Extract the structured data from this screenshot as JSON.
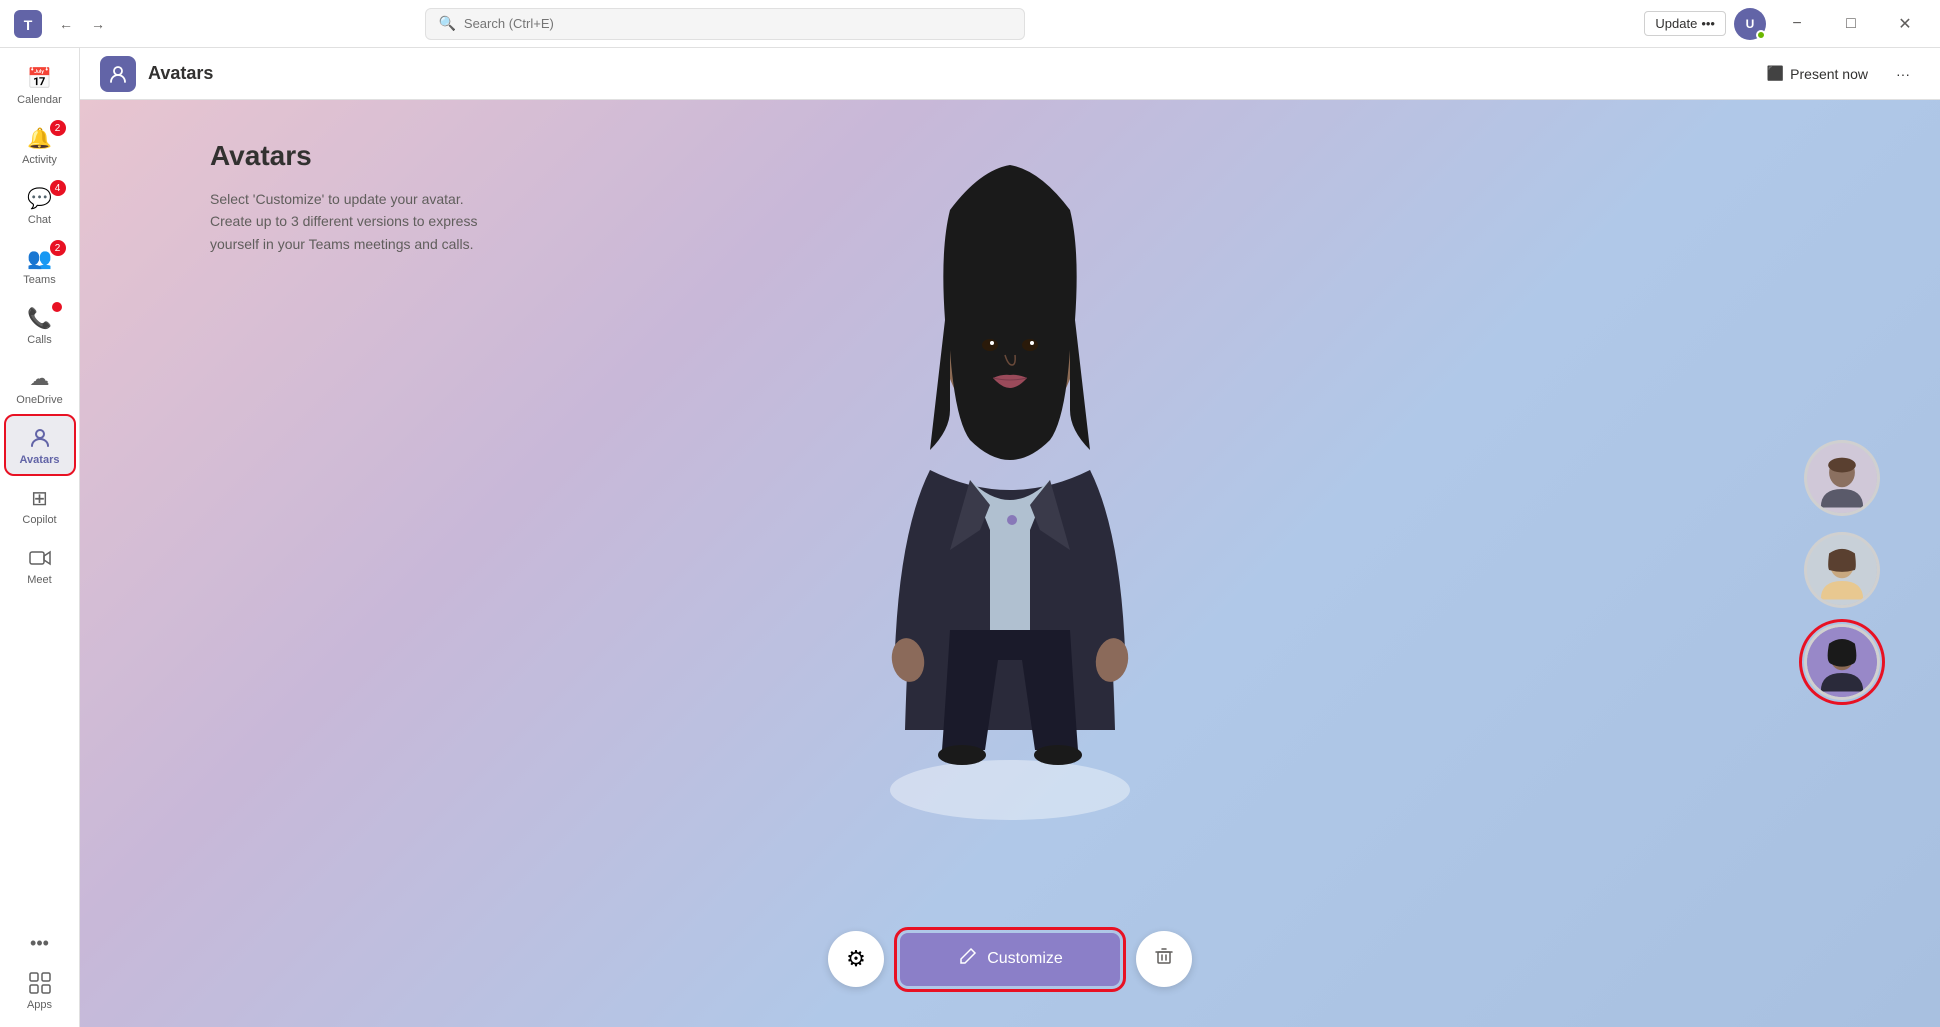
{
  "window": {
    "title": "Avatars",
    "minimize": "−",
    "maximize": "□",
    "close": "✕"
  },
  "titlebar": {
    "back_title": "Back",
    "forward_title": "Forward",
    "search_placeholder": "Search (Ctrl+E)",
    "update_label": "Update",
    "more_label": "···"
  },
  "sidebar": {
    "items": [
      {
        "id": "calendar",
        "label": "Calendar",
        "icon": "📅",
        "badge": null
      },
      {
        "id": "activity",
        "label": "Activity",
        "icon": "🔔",
        "badge": "2"
      },
      {
        "id": "chat",
        "label": "Chat",
        "icon": "💬",
        "badge": "4"
      },
      {
        "id": "teams",
        "label": "Teams",
        "icon": "👥",
        "badge": "2"
      },
      {
        "id": "calls",
        "label": "Calls",
        "icon": "📞",
        "badge_dot": true
      },
      {
        "id": "onedrive",
        "label": "OneDrive",
        "icon": "☁",
        "badge": null
      },
      {
        "id": "avatars",
        "label": "Avatars",
        "icon": "👤",
        "badge": null,
        "active": true
      },
      {
        "id": "copilot",
        "label": "Copilot",
        "icon": "⊞",
        "badge": null
      },
      {
        "id": "meet",
        "label": "Meet",
        "icon": "🎥",
        "badge": null
      }
    ],
    "more_label": "•••",
    "apps_label": "Apps"
  },
  "page_header": {
    "icon": "👤",
    "title": "Avatars",
    "present_now": "Present now",
    "more_label": "···"
  },
  "avatar_panel": {
    "title": "Avatars",
    "description_line1": "Select 'Customize' to update your avatar.",
    "description_line2": "Create up to 3 different versions to express",
    "description_line3": "yourself in your Teams meetings and calls."
  },
  "controls": {
    "settings_icon": "⚙",
    "customize_icon": "✏",
    "customize_label": "Customize",
    "delete_icon": "🗑"
  },
  "colors": {
    "accent": "#6264a7",
    "danger": "#e81123",
    "bg_gradient_start": "#e8c5d0",
    "bg_gradient_end": "#a8c0e0"
  }
}
